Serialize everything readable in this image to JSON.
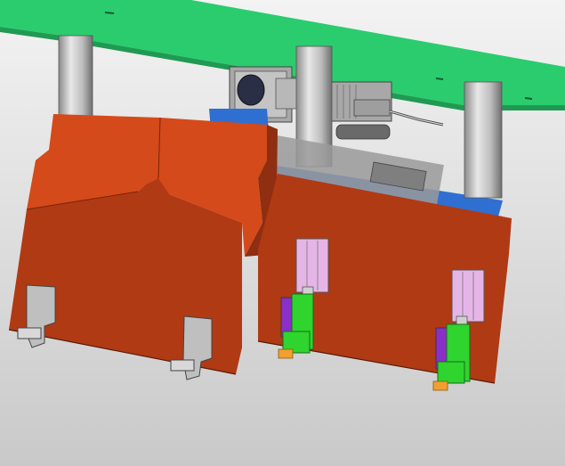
{
  "scene": {
    "subject": "cad-machine-assembly",
    "parts": [
      "green-mounting-plate",
      "support-column",
      "orange-housing",
      "blue-base-plate",
      "gear-motor",
      "pneumatic-cylinder",
      "green-gripper",
      "clamp-bracket"
    ],
    "colors": {
      "background_top": "#f3f3f3",
      "background_bottom": "#c9c9c9",
      "green_plate": "#2bcc6e",
      "green_plate_edge": "#1f9a52",
      "orange_main": "#d44a1a",
      "orange_dark": "#b03a14",
      "orange_shadow": "#8f2e10",
      "blue_plate": "#2f6fd1",
      "blue_plate_edge": "#1d4fa2",
      "column_light": "#e6e6e6",
      "column_dark": "#7e7e7e",
      "motor_gray": "#a8a8a8",
      "cylinder_pink": "#e5b5e8",
      "gripper_green": "#2fd42f",
      "gripper_purple": "#8a2fc8",
      "tip_orange": "#f0a030"
    }
  }
}
